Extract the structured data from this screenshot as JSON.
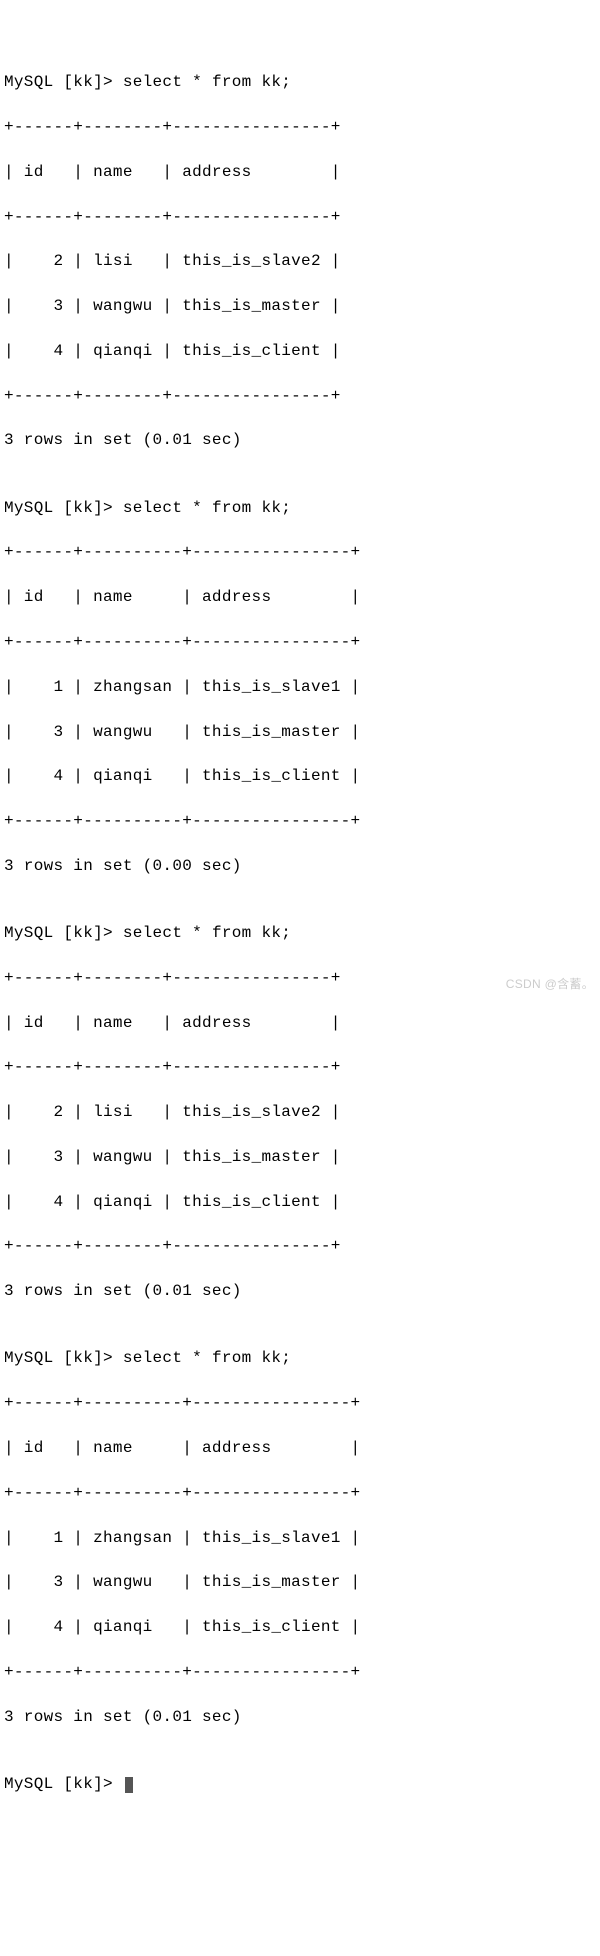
{
  "prompt": "MySQL [kk]> ",
  "query": "select * from kk;",
  "divider1": "+------+--------+----------------+",
  "divider2": "+------+----------+----------------+",
  "header1": "| id   | name   | address        |",
  "header2": "| id   | name     | address        |",
  "status001": "3 rows in set (0.01 sec)",
  "status000": "3 rows in set (0.00 sec)",
  "tableA": {
    "r0": "|    2 | lisi   | this_is_slave2 |",
    "r1": "|    3 | wangwu | this_is_master |",
    "r2": "|    4 | qianqi | this_is_client |"
  },
  "tableB": {
    "r0": "|    1 | zhangsan | this_is_slave1 |",
    "r1": "|    3 | wangwu   | this_is_master |",
    "r2": "|    4 | qianqi   | this_is_client |"
  },
  "chart_data": [
    {
      "type": "table",
      "columns": [
        "id",
        "name",
        "address"
      ],
      "rows": [
        [
          2,
          "lisi",
          "this_is_slave2"
        ],
        [
          3,
          "wangwu",
          "this_is_master"
        ],
        [
          4,
          "qianqi",
          "this_is_client"
        ]
      ],
      "status": "3 rows in set (0.01 sec)"
    },
    {
      "type": "table",
      "columns": [
        "id",
        "name",
        "address"
      ],
      "rows": [
        [
          1,
          "zhangsan",
          "this_is_slave1"
        ],
        [
          3,
          "wangwu",
          "this_is_master"
        ],
        [
          4,
          "qianqi",
          "this_is_client"
        ]
      ],
      "status": "3 rows in set (0.00 sec)"
    },
    {
      "type": "table",
      "columns": [
        "id",
        "name",
        "address"
      ],
      "rows": [
        [
          2,
          "lisi",
          "this_is_slave2"
        ],
        [
          3,
          "wangwu",
          "this_is_master"
        ],
        [
          4,
          "qianqi",
          "this_is_client"
        ]
      ],
      "status": "3 rows in set (0.01 sec)"
    },
    {
      "type": "table",
      "columns": [
        "id",
        "name",
        "address"
      ],
      "rows": [
        [
          1,
          "zhangsan",
          "this_is_slave1"
        ],
        [
          3,
          "wangwu",
          "this_is_master"
        ],
        [
          4,
          "qianqi",
          "this_is_client"
        ]
      ],
      "status": "3 rows in set (0.01 sec)"
    }
  ],
  "watermark": "CSDN @含蓄。"
}
